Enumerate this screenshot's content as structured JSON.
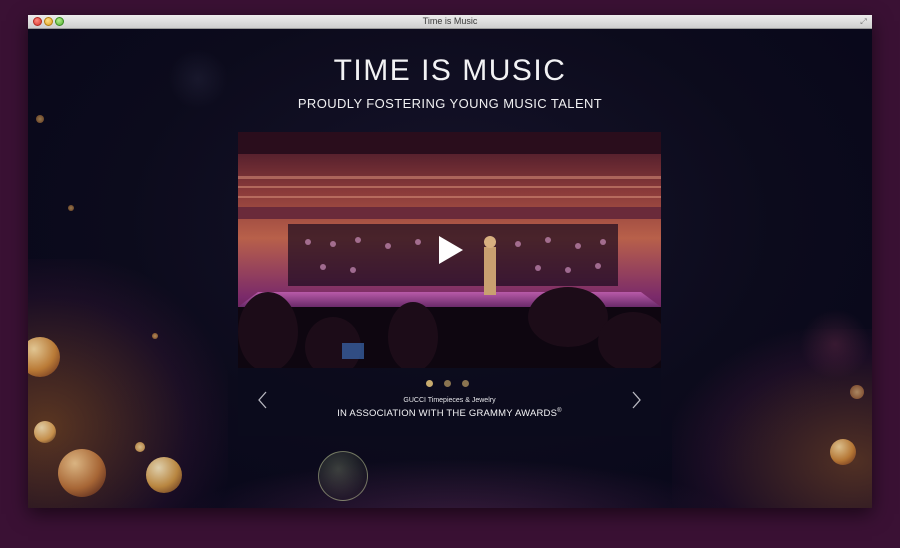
{
  "window": {
    "title": "Time is Music"
  },
  "page": {
    "title": "TIME IS MUSIC",
    "subtitle": "PROUDLY FOSTERING YOUNG MUSIC TALENT"
  },
  "video": {
    "play_icon": "play-icon"
  },
  "carousel": {
    "slide_count": 3,
    "active_index": 0,
    "prev_icon": "chevron-left-icon",
    "next_icon": "chevron-right-icon"
  },
  "sponsor": {
    "line1": "GUCCI Timepieces & Jewelry",
    "line2": "IN ASSOCIATION WITH THE GRAMMY AWARDS",
    "registered_mark": "®"
  },
  "colors": {
    "background": "#0b0a1a",
    "desktop": "#3a1134",
    "accent_gold": "#c8ab6e",
    "text": "#f2f2f4"
  }
}
